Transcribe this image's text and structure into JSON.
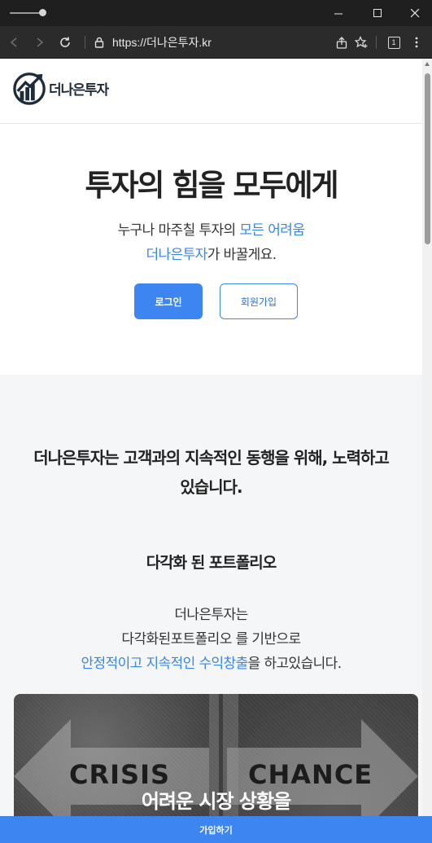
{
  "browser": {
    "url": "https://더나은투자.kr",
    "tab_count": "1"
  },
  "site": {
    "logo_text": "더나은투자"
  },
  "hero": {
    "title": "투자의 힘을 모두에게",
    "line1_prefix": "누구나 마주칠 투자의 ",
    "line1_accent": "모든 어려움",
    "line2_accent": "더나은투자",
    "line2_suffix": "가 바꿀게요.",
    "login_label": "로그인",
    "join_label": "회원가입"
  },
  "about": {
    "headline_line1": "더나은투자는 고객과의 지속적인 동행을 위해, 노력하고",
    "headline_line2": "있습니다.",
    "subtitle": "다각화 된 포트폴리오",
    "desc_line1": "더나은투자는",
    "desc_line2": "다각화된포트폴리오 를 기반으로",
    "desc_line3_accent": "안정적이고 지속적인 수익창출",
    "desc_line3_suffix": "을 하고있습니다."
  },
  "banner": {
    "word_left": "CRISIS",
    "word_right": "CHANCE",
    "caption": "어려운 시장 상황을"
  },
  "footer_cta": {
    "label": "가입하기"
  },
  "colors": {
    "accent": "#3d86f2",
    "accent_text": "#3a86e8",
    "section_bg": "#f4f6f7"
  }
}
